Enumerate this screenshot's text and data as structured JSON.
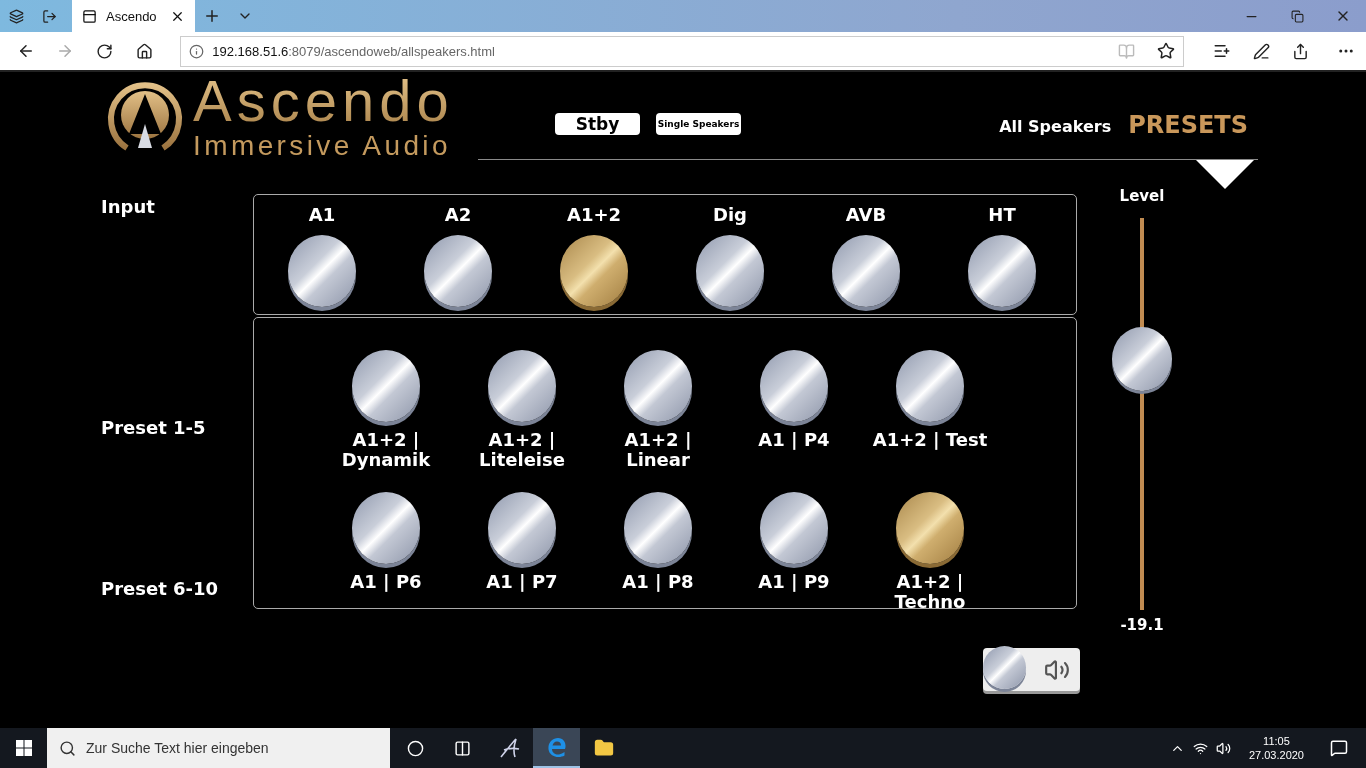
{
  "browser": {
    "tab_title": "Ascendo",
    "url_host": "192.168.51.6",
    "url_rest": ":8079/ascendoweb/allspeakers.html"
  },
  "header": {
    "brand": "Ascendo",
    "tagline": "Immersive Audio",
    "buttons": [
      {
        "label": "Stby",
        "kind": "large"
      },
      {
        "label": "Single Speakers",
        "kind": "small"
      }
    ],
    "nav": [
      {
        "label": "All Speakers",
        "selected": false
      },
      {
        "label": "PRESETS",
        "selected": true
      }
    ]
  },
  "input": {
    "label": "Input",
    "sources": [
      {
        "label": "A1",
        "selected": false
      },
      {
        "label": "A2",
        "selected": false
      },
      {
        "label": "A1+2",
        "selected": true
      },
      {
        "label": "Dig",
        "selected": false
      },
      {
        "label": "AVB",
        "selected": false
      },
      {
        "label": "HT",
        "selected": false
      }
    ]
  },
  "presets": [
    {
      "label": "Preset 1-5",
      "items": [
        {
          "label": "A1+2 |\nDynamik",
          "selected": false
        },
        {
          "label": "A1+2 |\nLiteleise",
          "selected": false
        },
        {
          "label": "A1+2 |\nLinear",
          "selected": false
        },
        {
          "label": "A1 | P4",
          "selected": false
        },
        {
          "label": "A1+2 | Test",
          "selected": false
        }
      ]
    },
    {
      "label": "Preset 6-10",
      "items": [
        {
          "label": "A1 | P6",
          "selected": false
        },
        {
          "label": "A1 | P7",
          "selected": false
        },
        {
          "label": "A1 | P8",
          "selected": false
        },
        {
          "label": "A1 | P9",
          "selected": false
        },
        {
          "label": "A1+2 |\nTechno",
          "selected": true
        }
      ]
    }
  ],
  "level": {
    "label": "Level",
    "level": 0.64,
    "reading": "-19.1"
  },
  "mute": {
    "on": false
  },
  "taskbar": {
    "search_placeholder": "Zur Suche Text hier eingeben",
    "time": "11:05",
    "date": "27.03.2020"
  }
}
